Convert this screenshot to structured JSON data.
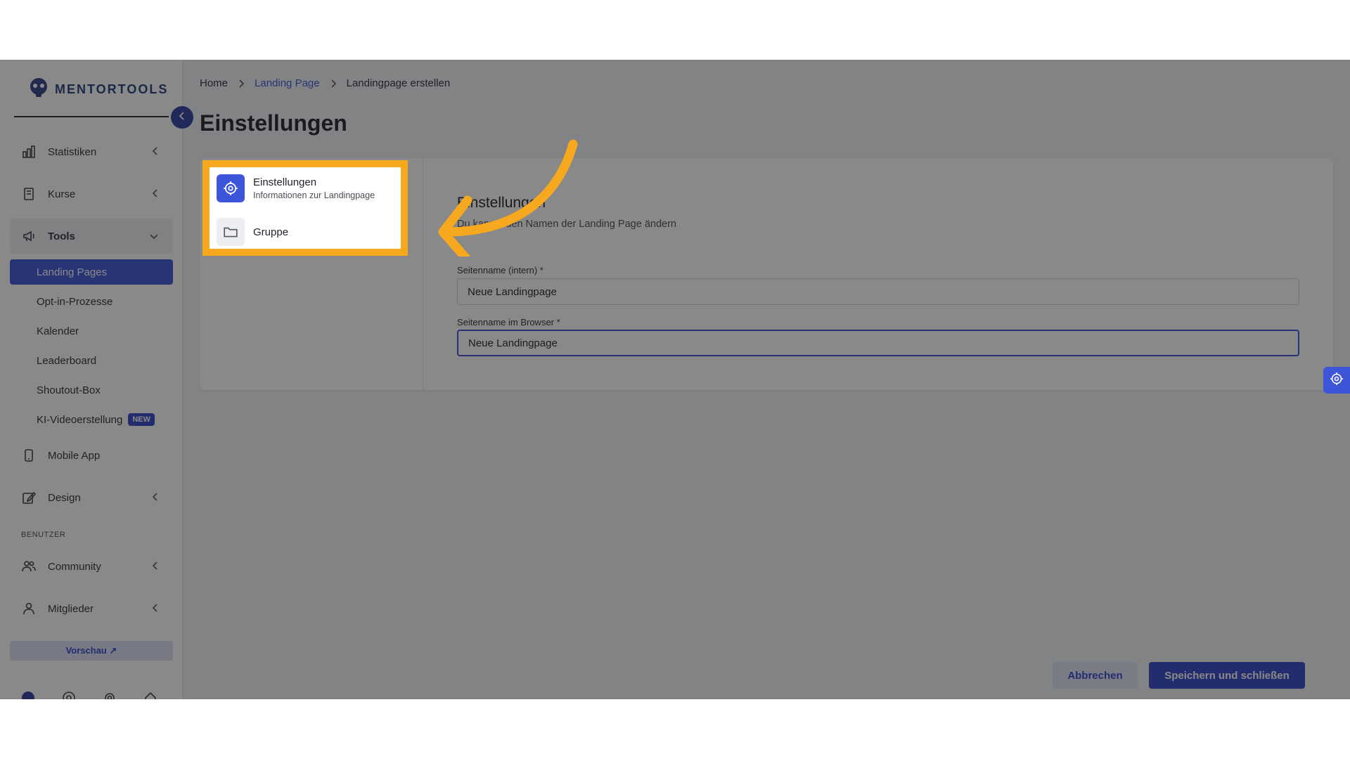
{
  "brand": {
    "name": "MENTORTOOLS"
  },
  "sidebar": {
    "groups": [
      {
        "label": "Statistiken",
        "icon": "bar-chart-icon"
      },
      {
        "label": "Kurse",
        "icon": "book-icon"
      },
      {
        "label": "Tools",
        "icon": "megaphone-icon"
      },
      {
        "label": "Mobile App",
        "icon": "phone-icon"
      },
      {
        "label": "Design",
        "icon": "edit-icon"
      }
    ],
    "tools_sub": [
      {
        "label": "Landing Pages"
      },
      {
        "label": "Opt-in-Prozesse"
      },
      {
        "label": "Kalender"
      },
      {
        "label": "Leaderboard"
      },
      {
        "label": "Shoutout-Box"
      },
      {
        "label": "KI-Videoerstellung",
        "badge": "NEW"
      }
    ],
    "section_user": "BENUTZER",
    "user_groups": [
      {
        "label": "Community",
        "icon": "users-icon"
      },
      {
        "label": "Mitglieder",
        "icon": "user-icon"
      }
    ],
    "preview_label": "Vorschau ↗"
  },
  "breadcrumb": {
    "home": "Home",
    "parent": "Landing Page",
    "current": "Landingpage erstellen"
  },
  "page": {
    "title": "Einstellungen"
  },
  "steps": [
    {
      "title": "Einstellungen",
      "subtitle": "Informationen zur Landingpage",
      "icon": "gear-icon"
    },
    {
      "title": "Gruppe",
      "icon": "folder-icon"
    }
  ],
  "form": {
    "title": "Einstellungen",
    "subtitle": "Du kannst den Namen der Landing Page ändern",
    "fields": [
      {
        "label": "Seitenname (intern) *",
        "value": "Neue Landingpage"
      },
      {
        "label": "Seitenname im Browser *",
        "value": "Neue Landingpage"
      }
    ]
  },
  "actions": {
    "cancel": "Abbrechen",
    "save": "Speichern und schließen"
  },
  "colors": {
    "accent": "#3d55d9",
    "highlight": "#f6a81f",
    "overlay": "rgba(20,20,20,0.5)"
  }
}
